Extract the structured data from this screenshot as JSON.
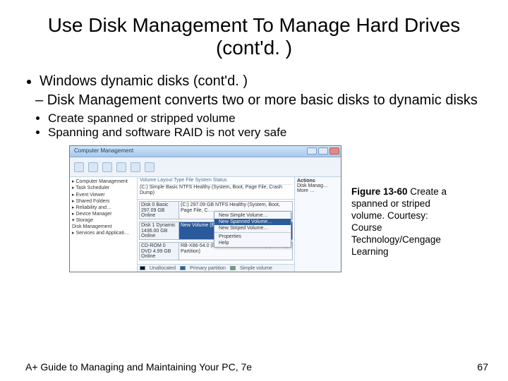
{
  "title": "Use Disk Management To Manage Hard Drives (cont'd. )",
  "bullets": {
    "l1": "Windows dynamic disks (cont'd. )",
    "l2": "Disk Management converts two or more basic disks to dynamic disks",
    "l3a": "Create spanned or stripped volume",
    "l3b": "Spanning and software RAID is not very safe"
  },
  "screenshot": {
    "window_title": "Computer Management",
    "tree": [
      "▸ Computer Management",
      "  ▸ Task Scheduler",
      "  ▸ Event Viewer",
      "  ▸ Shared Folders",
      "  ▸ Reliability and…",
      "  ▸ Device Manager",
      "  ▾ Storage",
      "      Disk Management",
      "  ▸ Services and Applicati…"
    ],
    "table_header": "Volume   Layout  Type  File System  Status",
    "table_row": "(C:)  Simple  Basic  NTFS   Healthy (System, Boot, Page File, Crash Dump)",
    "disks": [
      {
        "label": "Disk 0\nBasic\n297.09 GB\nOnline",
        "part": "(C:)\n297.09 GB NTFS\nHealthy (System, Boot, Page File, C…",
        "sel": false
      },
      {
        "label": "Disk 1\nDynamic\n1436.00 GB\nOnline",
        "part": "New Volume (E:)\n1436.00 GB\nUnallocated",
        "sel": true
      },
      {
        "label": "CD-ROM 0\nDVD\n4.99 GB\nOnline",
        "part": "RB-X86-54.0 (D:)\n4.99 GB UDF\nHealthy (Primary Partition)",
        "sel": false
      }
    ],
    "context_menu": [
      "New Simple Volume…",
      "New Spanned Volume…",
      "New Striped Volume…",
      "Properties",
      "Help"
    ],
    "context_selected": 1,
    "actions_label": "Actions",
    "actions_sub": "Disk Manag…",
    "actions_more": "More …",
    "legend": {
      "un": "Unallocated",
      "pr": "Primary partition",
      "sv": "Simple volume"
    }
  },
  "caption_bold": "Figure 13-60",
  "caption_rest": " Create a spanned or striped volume. Courtesy: Course Technology/Cengage Learning",
  "footer_left": "A+ Guide to Managing and Maintaining Your PC, 7e",
  "page_number": "67"
}
